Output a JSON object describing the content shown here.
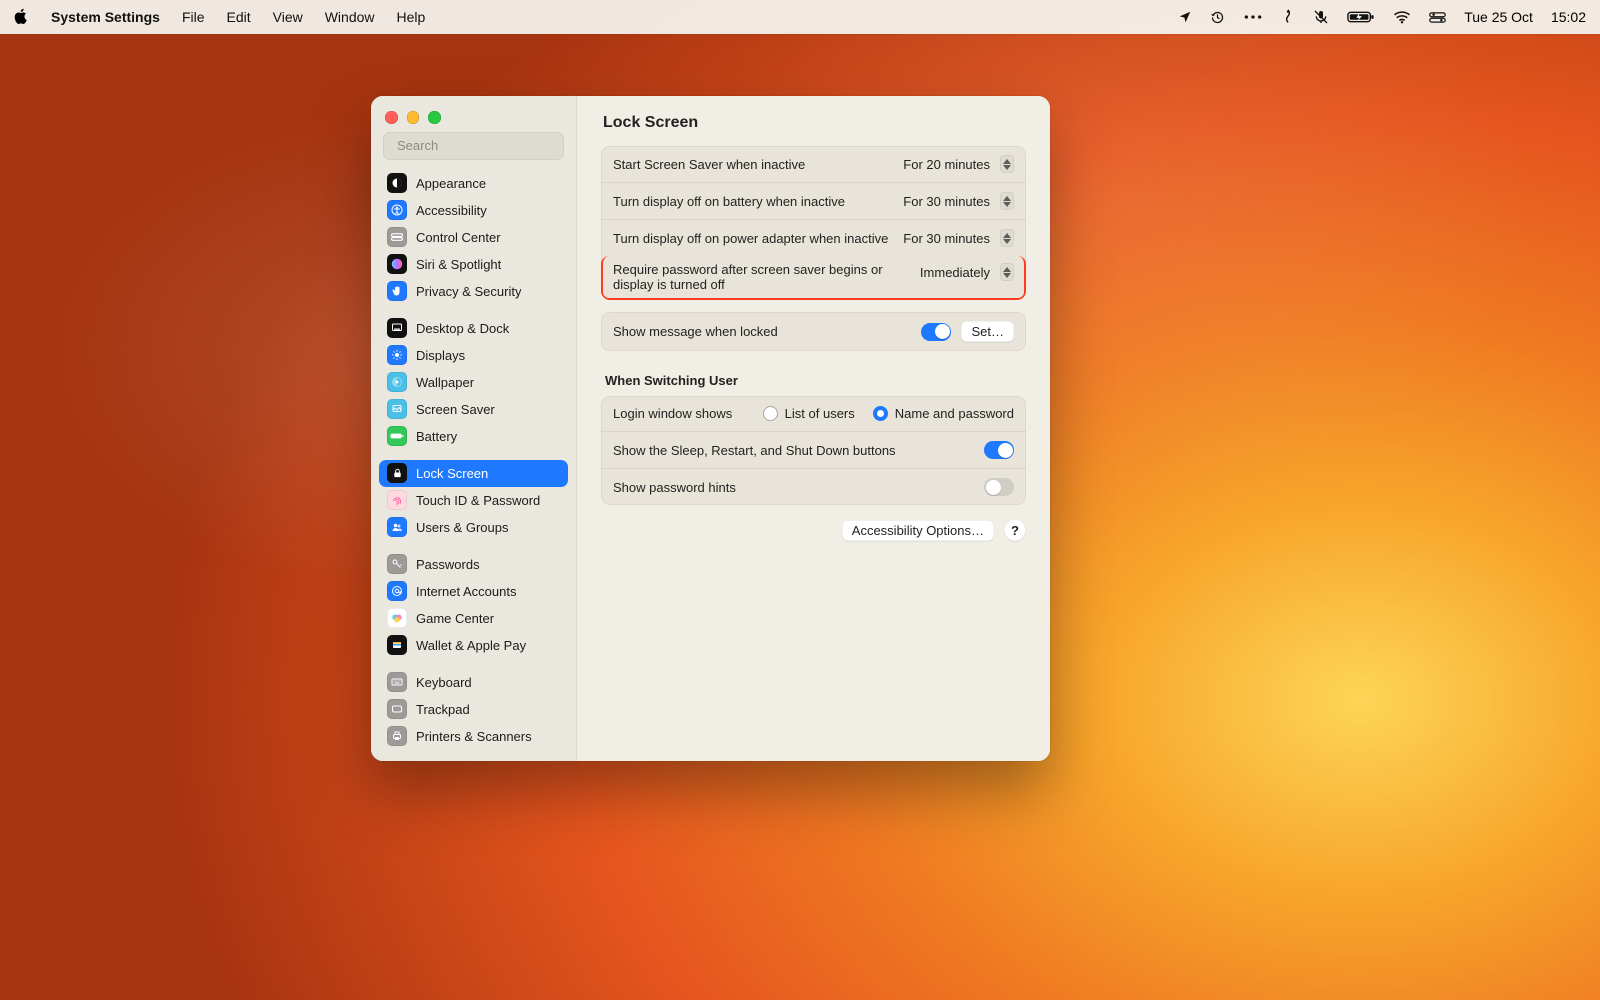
{
  "menubar": {
    "app_name": "System Settings",
    "items": [
      "File",
      "Edit",
      "View",
      "Window",
      "Help"
    ],
    "date": "Tue 25 Oct",
    "time": "15:02"
  },
  "window": {
    "search_placeholder": "Search",
    "title": "Lock Screen"
  },
  "sidebar": {
    "groups": [
      {
        "items": [
          {
            "id": "appearance",
            "label": "Appearance",
            "icon": "appearance",
            "bg": "#111"
          },
          {
            "id": "accessibility",
            "label": "Accessibility",
            "icon": "accessibility",
            "bg": "#1f79ff"
          },
          {
            "id": "control-center",
            "label": "Control Center",
            "icon": "control-center",
            "bg": "#9c9b97"
          },
          {
            "id": "siri-spotlight",
            "label": "Siri & Spotlight",
            "icon": "siri",
            "bg": "#111"
          },
          {
            "id": "privacy-security",
            "label": "Privacy & Security",
            "icon": "hand",
            "bg": "#1f79ff"
          }
        ]
      },
      {
        "items": [
          {
            "id": "desktop-dock",
            "label": "Desktop & Dock",
            "icon": "dock",
            "bg": "#111"
          },
          {
            "id": "displays",
            "label": "Displays",
            "icon": "displays",
            "bg": "#1f79ff"
          },
          {
            "id": "wallpaper",
            "label": "Wallpaper",
            "icon": "wallpaper",
            "bg": "#4ac0e8"
          },
          {
            "id": "screen-saver",
            "label": "Screen Saver",
            "icon": "screensaver",
            "bg": "#4ac0e8"
          },
          {
            "id": "battery",
            "label": "Battery",
            "icon": "battery",
            "bg": "#34c759"
          }
        ]
      },
      {
        "items": [
          {
            "id": "lock-screen",
            "label": "Lock Screen",
            "icon": "lock",
            "bg": "#111",
            "selected": true
          },
          {
            "id": "touch-id",
            "label": "Touch ID & Password",
            "icon": "fingerprint",
            "bg": "#ffd9e1"
          },
          {
            "id": "users-groups",
            "label": "Users & Groups",
            "icon": "users",
            "bg": "#1f79ff"
          }
        ]
      },
      {
        "items": [
          {
            "id": "passwords",
            "label": "Passwords",
            "icon": "key",
            "bg": "#9c9b97"
          },
          {
            "id": "internet-accounts",
            "label": "Internet Accounts",
            "icon": "at",
            "bg": "#1f79ff"
          },
          {
            "id": "game-center",
            "label": "Game Center",
            "icon": "gamecenter",
            "bg": "#fff"
          },
          {
            "id": "wallet",
            "label": "Wallet & Apple Pay",
            "icon": "wallet",
            "bg": "#111"
          }
        ]
      },
      {
        "items": [
          {
            "id": "keyboard",
            "label": "Keyboard",
            "icon": "keyboard",
            "bg": "#9c9b97"
          },
          {
            "id": "trackpad",
            "label": "Trackpad",
            "icon": "trackpad",
            "bg": "#9c9b97"
          },
          {
            "id": "printers",
            "label": "Printers & Scanners",
            "icon": "printer",
            "bg": "#9c9b97"
          }
        ]
      }
    ]
  },
  "main": {
    "rows": {
      "screensaver_inactive": {
        "label": "Start Screen Saver when inactive",
        "value": "For 20 minutes"
      },
      "display_off_battery": {
        "label": "Turn display off on battery when inactive",
        "value": "For 30 minutes"
      },
      "display_off_power": {
        "label": "Turn display off on power adapter when inactive",
        "value": "For 30 minutes"
      },
      "require_password": {
        "label": "Require password after screen saver begins or display is turned off",
        "value": "Immediately"
      },
      "show_message": {
        "label": "Show message when locked",
        "button": "Set…",
        "on": true
      }
    },
    "section_title": "When Switching User",
    "switching": {
      "login_window_shows": {
        "label": "Login window shows",
        "opt1": "List of users",
        "opt2": "Name and password",
        "selected": "opt2"
      },
      "show_sleep_buttons": {
        "label": "Show the Sleep, Restart, and Shut Down buttons",
        "on": true
      },
      "show_password_hints": {
        "label": "Show password hints",
        "on": false
      }
    },
    "accessibility_button": "Accessibility Options…",
    "help": "?"
  }
}
